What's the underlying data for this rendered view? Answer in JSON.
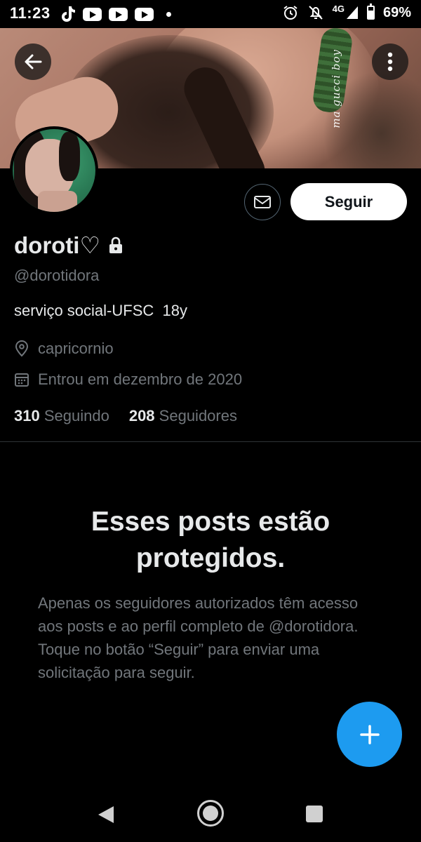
{
  "status_bar": {
    "time": "11:23",
    "network": "4G",
    "battery": "69%",
    "battery_level": 0.69,
    "icons": [
      "tiktok-icon",
      "youtube-icon",
      "youtube-icon",
      "youtube-icon",
      "notification-dot-icon",
      "alarm-icon",
      "notifications-off-icon",
      "signal-icon",
      "battery-icon"
    ]
  },
  "banner": {
    "overlay_text": "ma gucci boy",
    "back_icon": "arrow-left-icon",
    "more_icon": "more-vertical-icon"
  },
  "profile": {
    "display_name": "doroti♡",
    "locked_icon": "lock-icon",
    "handle": "@dorotidora",
    "bio": "serviço social-UFSC  18y",
    "location": "capricornio",
    "joined": "Entrou em dezembro de 2020",
    "following_count": "310",
    "following_label": "Seguindo",
    "followers_count": "208",
    "followers_label": "Seguidores"
  },
  "actions": {
    "message_icon": "mail-icon",
    "follow_label": "Seguir"
  },
  "protected": {
    "title": "Esses posts estão protegidos.",
    "description": "Apenas os seguidores autorizados têm acesso aos posts e ao perfil completo de @dorotidora. Toque no botão “Seguir” para enviar uma solicitação para seguir."
  },
  "fab": {
    "icon": "plus-icon"
  },
  "colors": {
    "accent": "#1d9bf0",
    "background": "#000000",
    "text_primary": "#e7e9ea",
    "text_secondary": "#71767b",
    "divider": "#2f3336"
  }
}
